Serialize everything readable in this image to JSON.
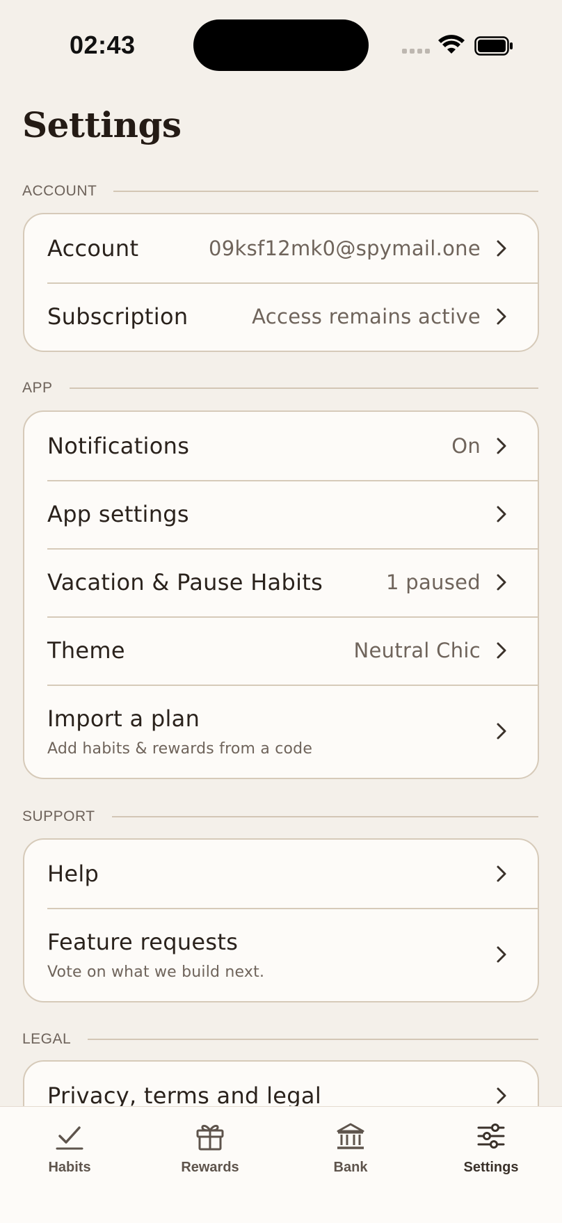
{
  "status_bar": {
    "time": "02:43"
  },
  "page_title": "Settings",
  "sections": {
    "account": {
      "header": "ACCOUNT",
      "rows": [
        {
          "label": "Account",
          "value": "09ksf12mk0@spymail.one"
        },
        {
          "label": "Subscription",
          "value": "Access remains active"
        }
      ]
    },
    "app": {
      "header": "APP",
      "rows": [
        {
          "label": "Notifications",
          "value": "On"
        },
        {
          "label": "App settings",
          "value": ""
        },
        {
          "label": "Vacation & Pause Habits",
          "value": "1 paused"
        },
        {
          "label": "Theme",
          "value": "Neutral Chic"
        },
        {
          "label": "Import a plan",
          "sublabel": "Add habits & rewards from a code"
        }
      ]
    },
    "support": {
      "header": "SUPPORT",
      "rows": [
        {
          "label": "Help"
        },
        {
          "label": "Feature requests",
          "sublabel": "Vote on what we build next."
        }
      ]
    },
    "legal": {
      "header": "LEGAL",
      "rows": [
        {
          "label": "Privacy, terms and legal"
        }
      ]
    }
  },
  "tab_bar": {
    "tabs": [
      {
        "label": "Habits",
        "icon": "checkmark-icon"
      },
      {
        "label": "Rewards",
        "icon": "gift-icon"
      },
      {
        "label": "Bank",
        "icon": "bank-icon"
      },
      {
        "label": "Settings",
        "icon": "sliders-icon",
        "active": true
      }
    ]
  },
  "colors": {
    "background": "#f4f0ea",
    "card": "#fdfbf8",
    "border": "#d6cab9",
    "text": "#2a221c",
    "muted": "#6f645b"
  }
}
